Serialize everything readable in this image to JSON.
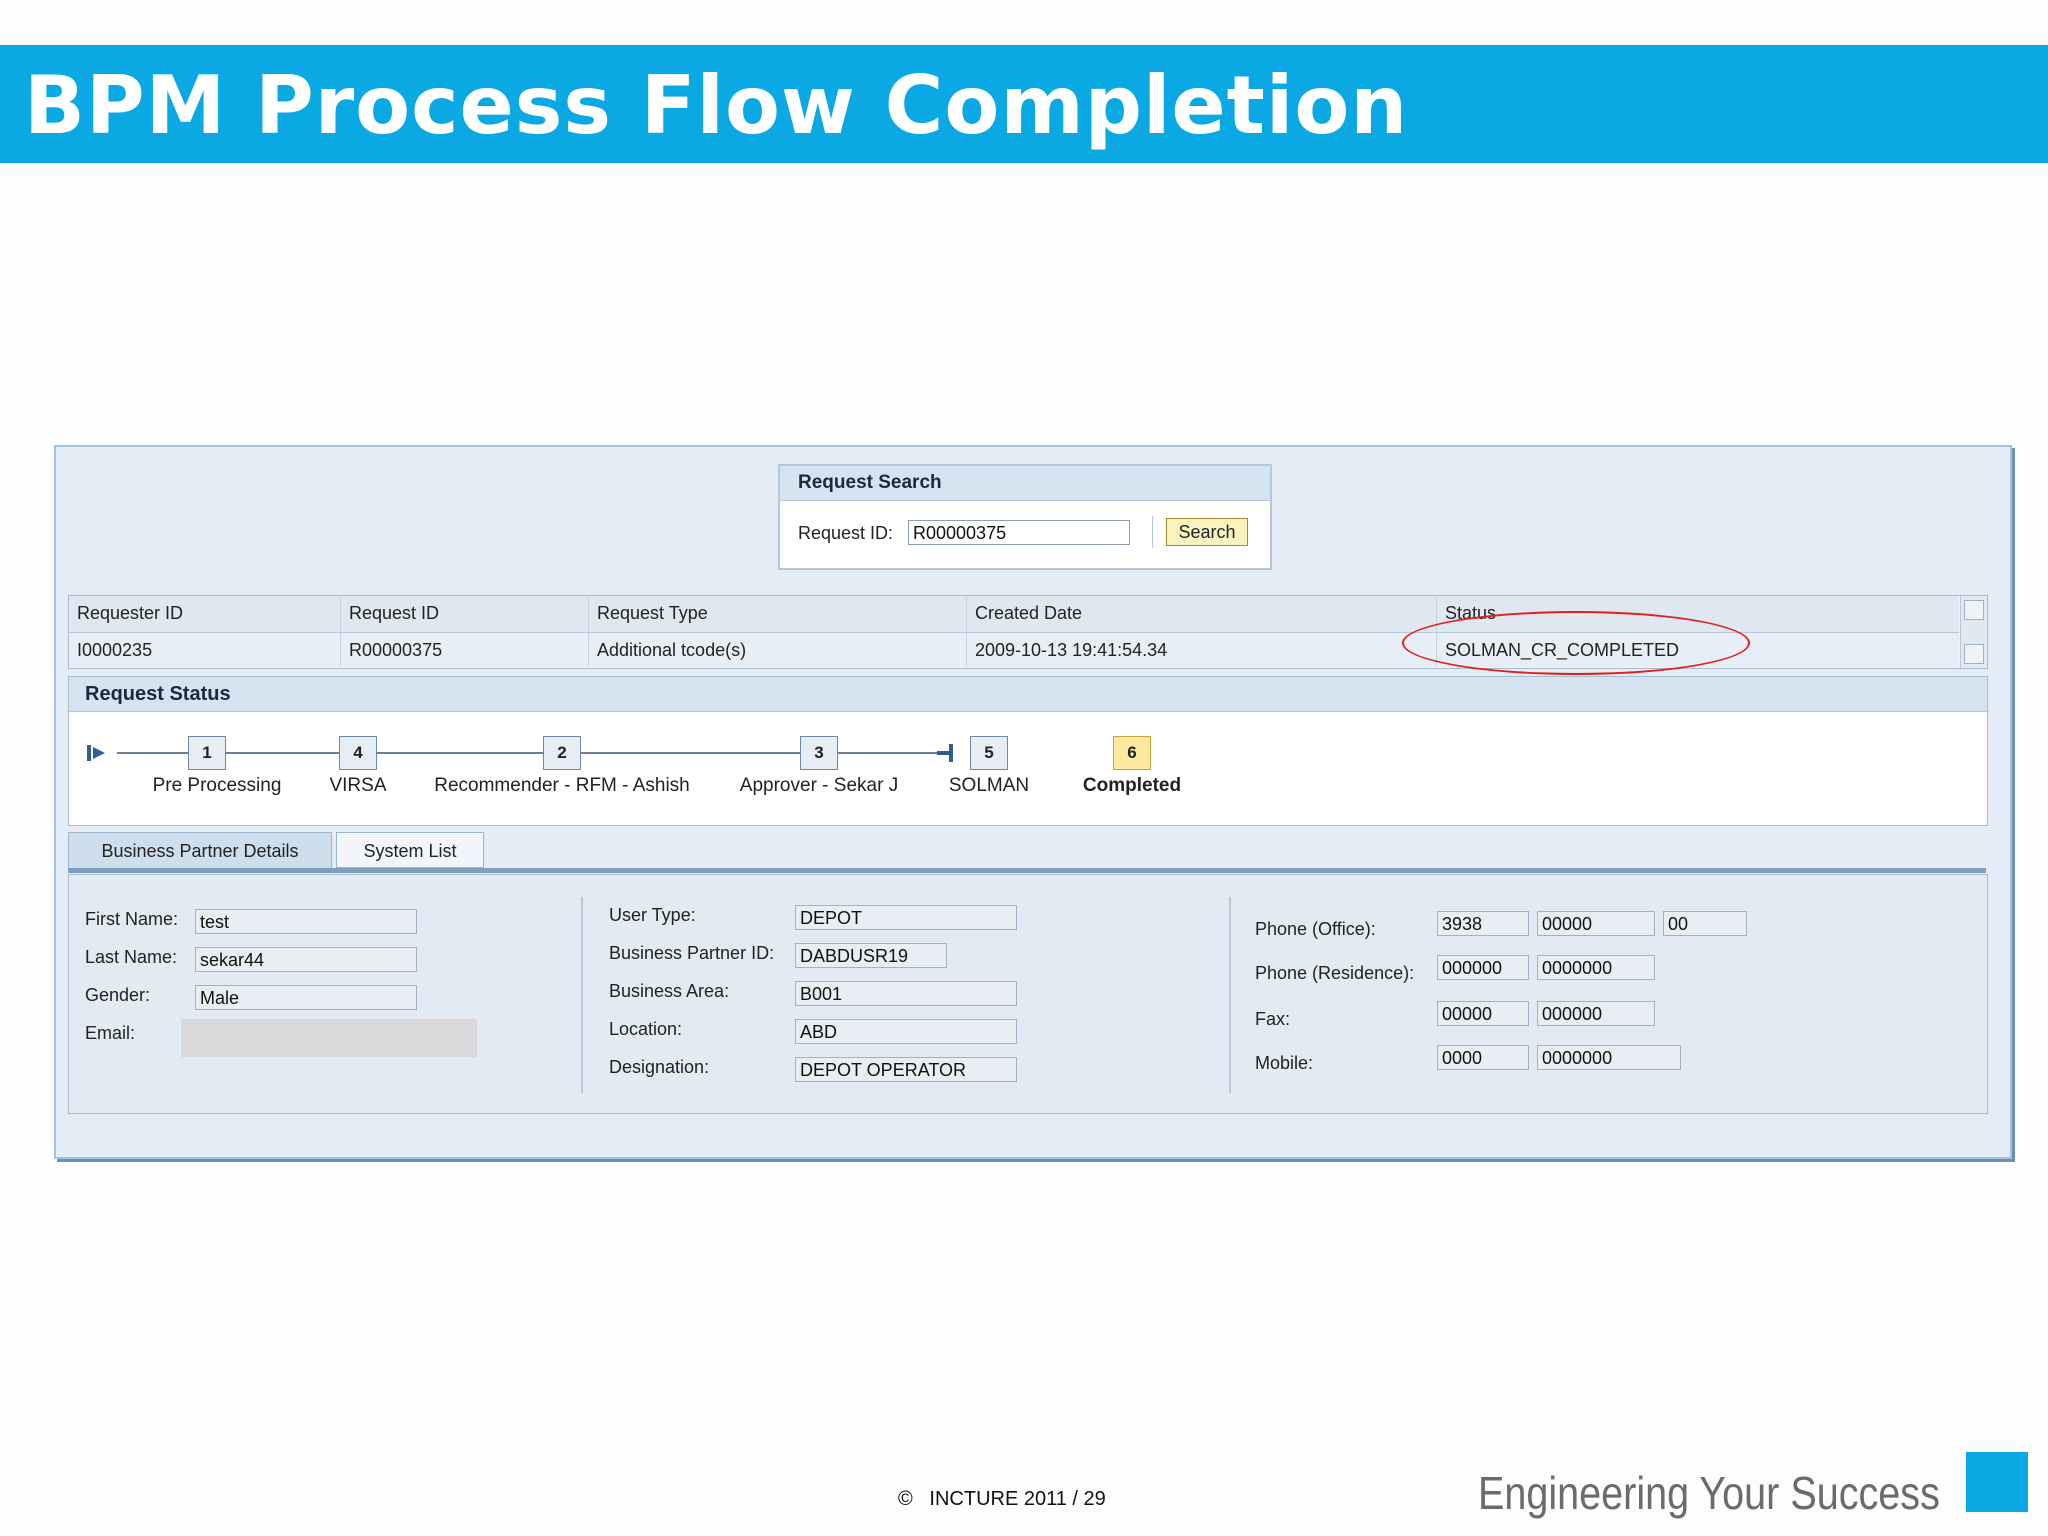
{
  "slide": {
    "title": "BPM Process Flow Completion",
    "footer": "©   INCTURE 2011 / 29",
    "tagline": "Engineering Your Success",
    "accent_color": "#0aa9e3"
  },
  "search": {
    "title": "Request Search",
    "request_id_label": "Request ID:",
    "request_id_value": "R00000375",
    "button_label": "Search"
  },
  "table": {
    "headers": [
      "Requester ID",
      "Request ID",
      "Request Type",
      "Created Date",
      "Status"
    ],
    "row": [
      "I0000235",
      "R00000375",
      "Additional tcode(s)",
      "2009-10-13 19:41:54.34",
      "SOLMAN_CR_COMPLETED"
    ]
  },
  "request_status": {
    "title": "Request Status",
    "steps": [
      {
        "num": "1",
        "label": "Pre Processing"
      },
      {
        "num": "4",
        "label": "VIRSA"
      },
      {
        "num": "2",
        "label": "Recommender - RFM - Ashish"
      },
      {
        "num": "3",
        "label": "Approver - Sekar J"
      },
      {
        "num": "5",
        "label": "SOLMAN"
      },
      {
        "num": "6",
        "label": "Completed"
      }
    ],
    "active_step": "6"
  },
  "tabs": [
    "Business Partner Details",
    "System List"
  ],
  "details": {
    "first_name_label": "First Name:",
    "first_name": "test",
    "last_name_label": "Last Name:",
    "last_name": "sekar44",
    "gender_label": "Gender:",
    "gender": "Male",
    "email_label": "Email:",
    "email": "",
    "user_type_label": "User Type:",
    "user_type": "DEPOT",
    "bp_id_label": "Business Partner ID:",
    "bp_id": "DABDUSR19",
    "business_area_label": "Business Area:",
    "business_area": "B001",
    "location_label": "Location:",
    "location": "ABD",
    "designation_label": "Designation:",
    "designation": "DEPOT OPERATOR",
    "phone_office_label": "Phone (Office):",
    "phone_office": [
      "3938",
      "00000",
      "00"
    ],
    "phone_res_label": "Phone (Residence):",
    "phone_res": [
      "000000",
      "0000000"
    ],
    "fax_label": "Fax:",
    "fax": [
      "00000",
      "000000"
    ],
    "mobile_label": "Mobile:",
    "mobile": [
      "0000",
      "0000000"
    ]
  }
}
